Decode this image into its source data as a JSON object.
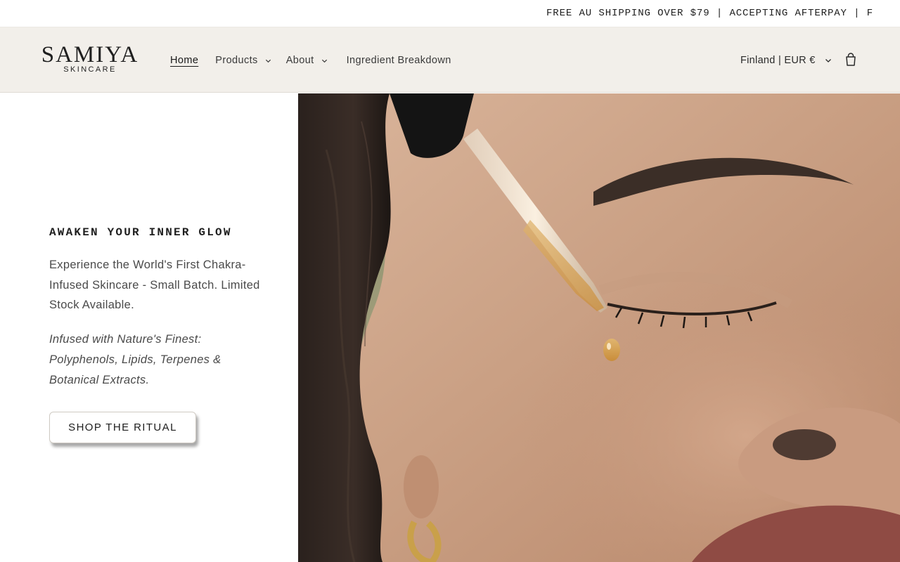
{
  "announcement": {
    "text": "FREE AU SHIPPING OVER $79 | ACCEPTING AFTERPAY | F"
  },
  "header": {
    "logo": {
      "main": "SAMIYA",
      "sub": "SKINCARE"
    },
    "nav": [
      {
        "label": "Home",
        "active": true,
        "has_dropdown": false
      },
      {
        "label": "Products",
        "active": false,
        "has_dropdown": true
      },
      {
        "label": "About",
        "active": false,
        "has_dropdown": true
      },
      {
        "label": "Ingredient Breakdown",
        "active": false,
        "has_dropdown": false
      }
    ],
    "locale_label": "Finland | EUR €",
    "icons": {
      "dropdown": "chevron-down-icon",
      "cart": "cart-icon"
    }
  },
  "hero": {
    "eyebrow": "AWAKEN YOUR INNER GLOW",
    "lead": "Experience the World's First Chakra-Infused Skincare - Small Batch. Limited Stock Available.",
    "italic_note": "Infused with Nature's Finest: Polyphenols, Lipids, Terpenes & Botanical Extracts.",
    "cta_label": "SHOP THE RITUAL",
    "image": "woman-applying-serum-dropper-near-closed-eye"
  },
  "colors": {
    "header_bg": "#f2efea",
    "page_bg": "#ffffff",
    "text": "#1f1f1f",
    "muted_text": "#4a4a4a"
  }
}
